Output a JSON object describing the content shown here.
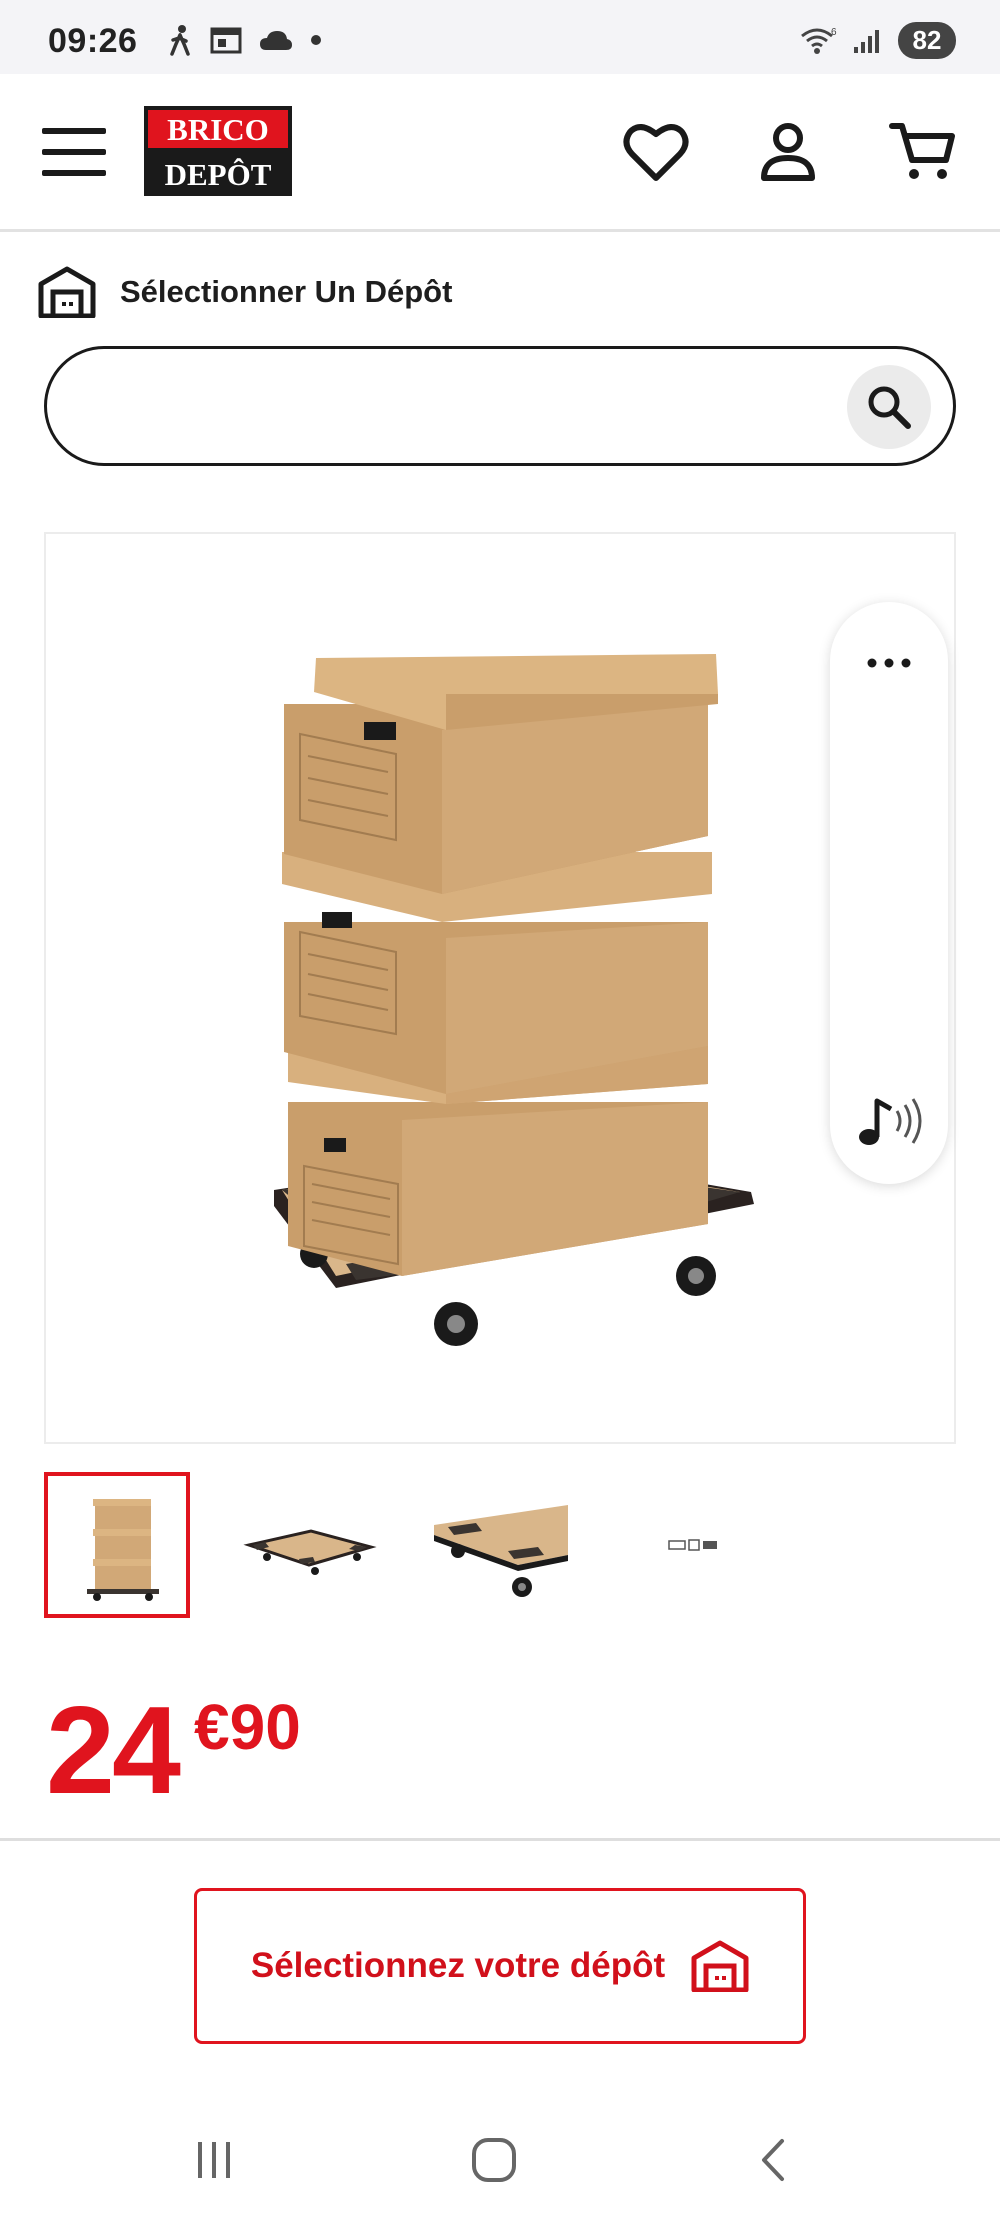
{
  "status_bar": {
    "time": "09:26",
    "battery": "82",
    "left_icons": [
      "walking-icon",
      "calendar-icon",
      "cloud-icon",
      "dot-icon"
    ],
    "right_icons": [
      "wifi-icon",
      "signal-icon"
    ]
  },
  "header": {
    "logo_line1": "BRICO",
    "logo_line2": "DEPÔT",
    "brand_color": "#e0141e",
    "icons": [
      "menu-icon",
      "heart-icon",
      "user-icon",
      "cart-icon"
    ]
  },
  "depot": {
    "label": "Sélectionner Un Dépôt"
  },
  "search": {
    "value": "",
    "placeholder": ""
  },
  "product": {
    "price_integer": "24",
    "price_decimal": "€90",
    "thumbnails_count": 4,
    "active_thumbnail": 1
  },
  "cta": {
    "label": "Sélectionnez votre dépôt"
  }
}
